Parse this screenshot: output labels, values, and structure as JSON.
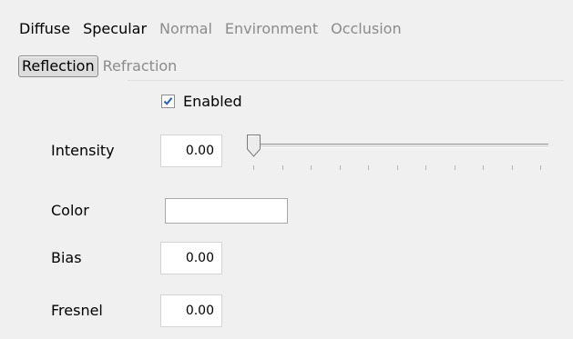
{
  "tabs_row1": [
    "Diffuse",
    "Specular",
    "Normal",
    "Environment",
    "Occlusion"
  ],
  "tabs_row2": [
    "Reflection",
    "Refraction"
  ],
  "selected_tab": "Reflection",
  "enabled": {
    "label": "Enabled",
    "checked": true
  },
  "fields": {
    "intensity": {
      "label": "Intensity",
      "value": "0.00"
    },
    "color": {
      "label": "Color",
      "value": ""
    },
    "bias": {
      "label": "Bias",
      "value": "0.00"
    },
    "fresnel": {
      "label": "Fresnel",
      "value": "0.00"
    }
  },
  "intensity_slider": {
    "level": 0.0,
    "tick_count": 11
  },
  "colors": {
    "checkmark": "#2a5db0",
    "panel_bg": "#f0f0f0"
  },
  "icons": {
    "checkbox": "checkmark-icon",
    "slider_thumb": "slider-thumb-icon"
  }
}
